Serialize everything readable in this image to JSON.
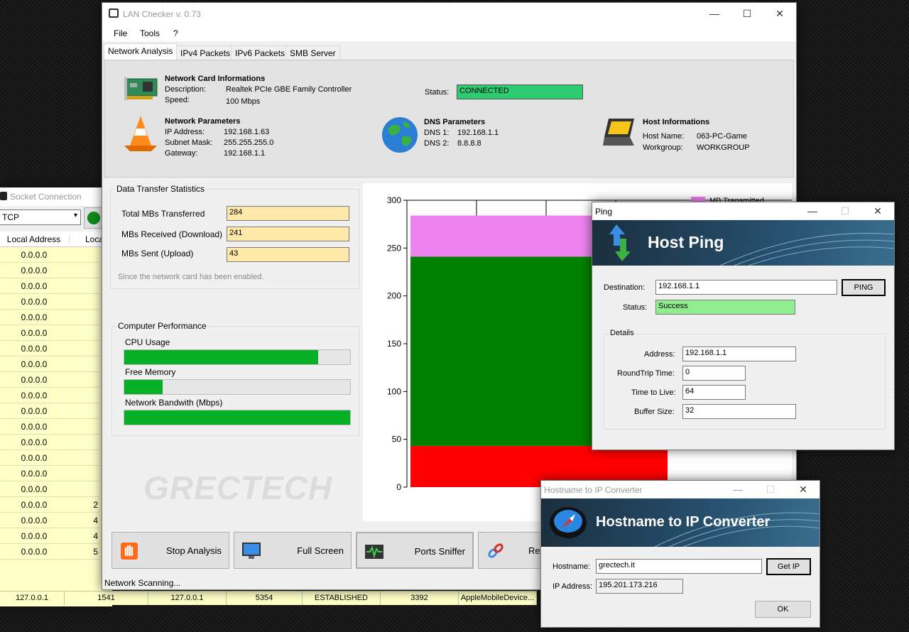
{
  "socket_window": {
    "title": "Socket Connection",
    "protocol": "TCP",
    "columns": [
      "Local Address",
      "Loca"
    ],
    "rows": [
      {
        "addr": "0.0.0.0",
        "port": ""
      },
      {
        "addr": "0.0.0.0",
        "port": ""
      },
      {
        "addr": "0.0.0.0",
        "port": ""
      },
      {
        "addr": "0.0.0.0",
        "port": ""
      },
      {
        "addr": "0.0.0.0",
        "port": ""
      },
      {
        "addr": "0.0.0.0",
        "port": ""
      },
      {
        "addr": "0.0.0.0",
        "port": ""
      },
      {
        "addr": "0.0.0.0",
        "port": ""
      },
      {
        "addr": "0.0.0.0",
        "port": ""
      },
      {
        "addr": "0.0.0.0",
        "port": ""
      },
      {
        "addr": "0.0.0.0",
        "port": ""
      },
      {
        "addr": "0.0.0.0",
        "port": ""
      },
      {
        "addr": "0.0.0.0",
        "port": ""
      },
      {
        "addr": "0.0.0.0",
        "port": ""
      },
      {
        "addr": "0.0.0.0",
        "port": ""
      },
      {
        "addr": "0.0.0.0",
        "port": ""
      },
      {
        "addr": "0.0.0.0",
        "port": "2"
      },
      {
        "addr": "0.0.0.0",
        "port": "4"
      },
      {
        "addr": "0.0.0.0",
        "port": "4"
      },
      {
        "addr": "0.0.0.0",
        "port": "5"
      }
    ],
    "last_row": [
      "127.0.0.1",
      "1541",
      "127.0.0.1",
      "5354",
      "ESTABLISHED",
      "3392",
      "AppleMobileDevice..."
    ]
  },
  "main_window": {
    "title": "LAN Checker v. 0.73",
    "menu": [
      "File",
      "Tools",
      "?"
    ],
    "tabs": [
      "Network Analysis",
      "IPv4 Packets",
      "IPv6 Packets",
      "SMB Server"
    ],
    "card": {
      "heading": "Network Card Informations",
      "description_label": "Description:",
      "description": "Realtek PCIe GBE Family Controller",
      "speed_label": "Speed:",
      "speed": "100 Mbps",
      "status_label": "Status:",
      "status": "CONNECTED"
    },
    "net": {
      "heading": "Network Parameters",
      "ip_label": "IP Address:",
      "ip": "192.168.1.63",
      "mask_label": "Subnet Mask:",
      "mask": "255.255.255.0",
      "gw_label": "Gateway:",
      "gw": "192.168.1.1"
    },
    "dns": {
      "heading": "DNS Parameters",
      "dns1_label": "DNS 1:",
      "dns1": "192.168.1.1",
      "dns2_label": "DNS 2:",
      "dns2": "8.8.8.8"
    },
    "host": {
      "heading": "Host Informations",
      "name_label": "Host Name:",
      "name": "063-PC-Game",
      "wg_label": "Workgroup:",
      "wg": "WORKGROUP"
    },
    "transfer": {
      "group_title": "Data Transfer Statistics",
      "total_label": "Total MBs Transferred",
      "total": "284",
      "recv_label": "MBs Received (Download)",
      "recv": "241",
      "sent_label": "MBs Sent (Upload)",
      "sent": "43",
      "note": "Since the network card has been enabled."
    },
    "performance": {
      "group_title": "Computer Performance",
      "cpu_label": "CPU Usage",
      "cpu_fraction": 0.86,
      "mem_label": "Free Memory",
      "mem_fraction": 0.17,
      "bw_label": "Network Bandwith (Mbps)",
      "bw_fraction": 1.0,
      "fill_color": "#06b025"
    },
    "watermark": "GRECTECH",
    "buttons": [
      "Stop Analysis",
      "Full Screen",
      "Ports Sniffer",
      "Res"
    ],
    "status_bar": "Network Scanning..."
  },
  "chart_data": {
    "type": "bar",
    "stacked": true,
    "categories": [
      ""
    ],
    "series": [
      {
        "name": "",
        "values": [
          43
        ],
        "color": "#ff0000"
      },
      {
        "name": "",
        "values": [
          198
        ],
        "color": "#008000"
      },
      {
        "name": "MB Transmitted",
        "values": [
          43
        ],
        "color": "#ee82ee"
      }
    ],
    "ylim": [
      0,
      300
    ],
    "yticks": [
      0,
      50,
      100,
      150,
      200,
      250,
      300
    ],
    "grid": true,
    "legend_position": "top-right"
  },
  "ping_window": {
    "title": "Ping",
    "banner": "Host Ping",
    "dest_label": "Destination:",
    "dest": "192.168.1.1",
    "ping_button": "PING",
    "status_label": "Status:",
    "status": "Success",
    "details_title": "Details",
    "address_label": "Address:",
    "address": "192.168.1.1",
    "rtt_label": "RoundTrip Time:",
    "rtt": "0",
    "ttl_label": "Time to Live:",
    "ttl": "64",
    "buffer_label": "Buffer Size:",
    "buffer": "32"
  },
  "converter_window": {
    "title": "Hostname to IP Converter",
    "banner": "Hostname to IP Converter",
    "hostname_label": "Hostname:",
    "hostname": "grectech.it",
    "get_ip_button": "Get IP",
    "ip_label": "IP Address:",
    "ip": "195.201.173.216",
    "ok_button": "OK"
  }
}
